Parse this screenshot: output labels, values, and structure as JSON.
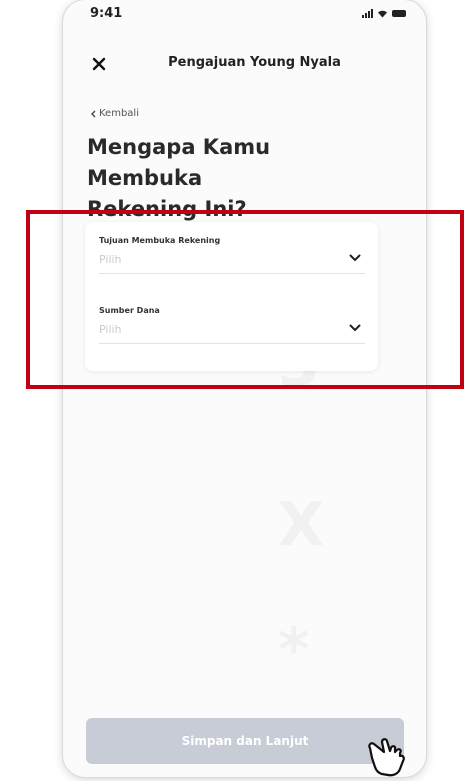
{
  "status_bar": {
    "time": "9:41"
  },
  "header": {
    "title": "Pengajuan Young Nyala",
    "close_icon": "close-icon"
  },
  "back_link": {
    "label": "Kembali"
  },
  "page": {
    "title_line1": "Mengapa Kamu Membuka",
    "title_line2": "Rekening Ini?"
  },
  "form": {
    "fields": [
      {
        "label": "Tujuan Membuka Rekening",
        "value": "Pilih"
      },
      {
        "label": "Sumber Dana",
        "value": "Pilih"
      }
    ]
  },
  "submit": {
    "label": "Simpan dan Lanjut"
  },
  "colors": {
    "highlight_border": "#c00010",
    "button_disabled": "#c8ccd6",
    "placeholder": "#c9cbd3"
  }
}
